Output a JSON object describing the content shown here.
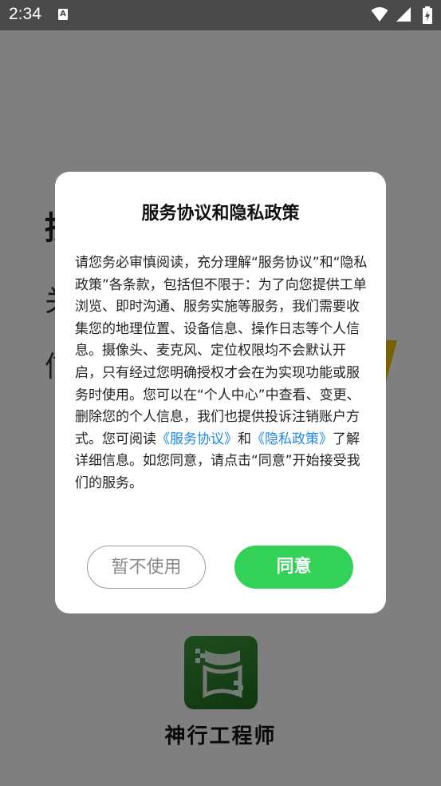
{
  "status_bar": {
    "time": "2:34",
    "notification_icon_letter": "A",
    "icons": [
      "wifi-icon",
      "signal-icon",
      "battery-icon"
    ]
  },
  "background": {
    "heading_fragment": "授",
    "line1_fragment": "关",
    "line2_fragment": "信",
    "app_name": "神行工程师"
  },
  "dialog": {
    "title": "服务协议和隐私政策",
    "body_part1": "请您务必审慎阅读，充分理解“服务协议”和“隐私政策”各条款，包括但不限于：为了向您提供工单浏览、即时沟通、服务实施等服务，我们需要收集您的地理位置、设备信息、操作日志等个人信息。摄像头、麦克风、定位权限均不会默认开启，只有经过您明确授权才会在为实现功能或服务时使用。您可以在“个人中心”中查看、变更、删除您的个人信息，我们也提供投诉注销账户方式。您可阅读",
    "link_service": "《服务协议》",
    "and_text": "和",
    "link_privacy": "《隐私政策》",
    "body_part2": "了解详细信息。如您同意，请点击“同意”开始接受我们的服务。",
    "decline_label": "暂不使用",
    "agree_label": "同意"
  },
  "colors": {
    "agree_green": "#34d158",
    "link_blue": "#1e88e5",
    "status_bar": "#4a4a4a",
    "logo_green": "#2e8a2e"
  }
}
